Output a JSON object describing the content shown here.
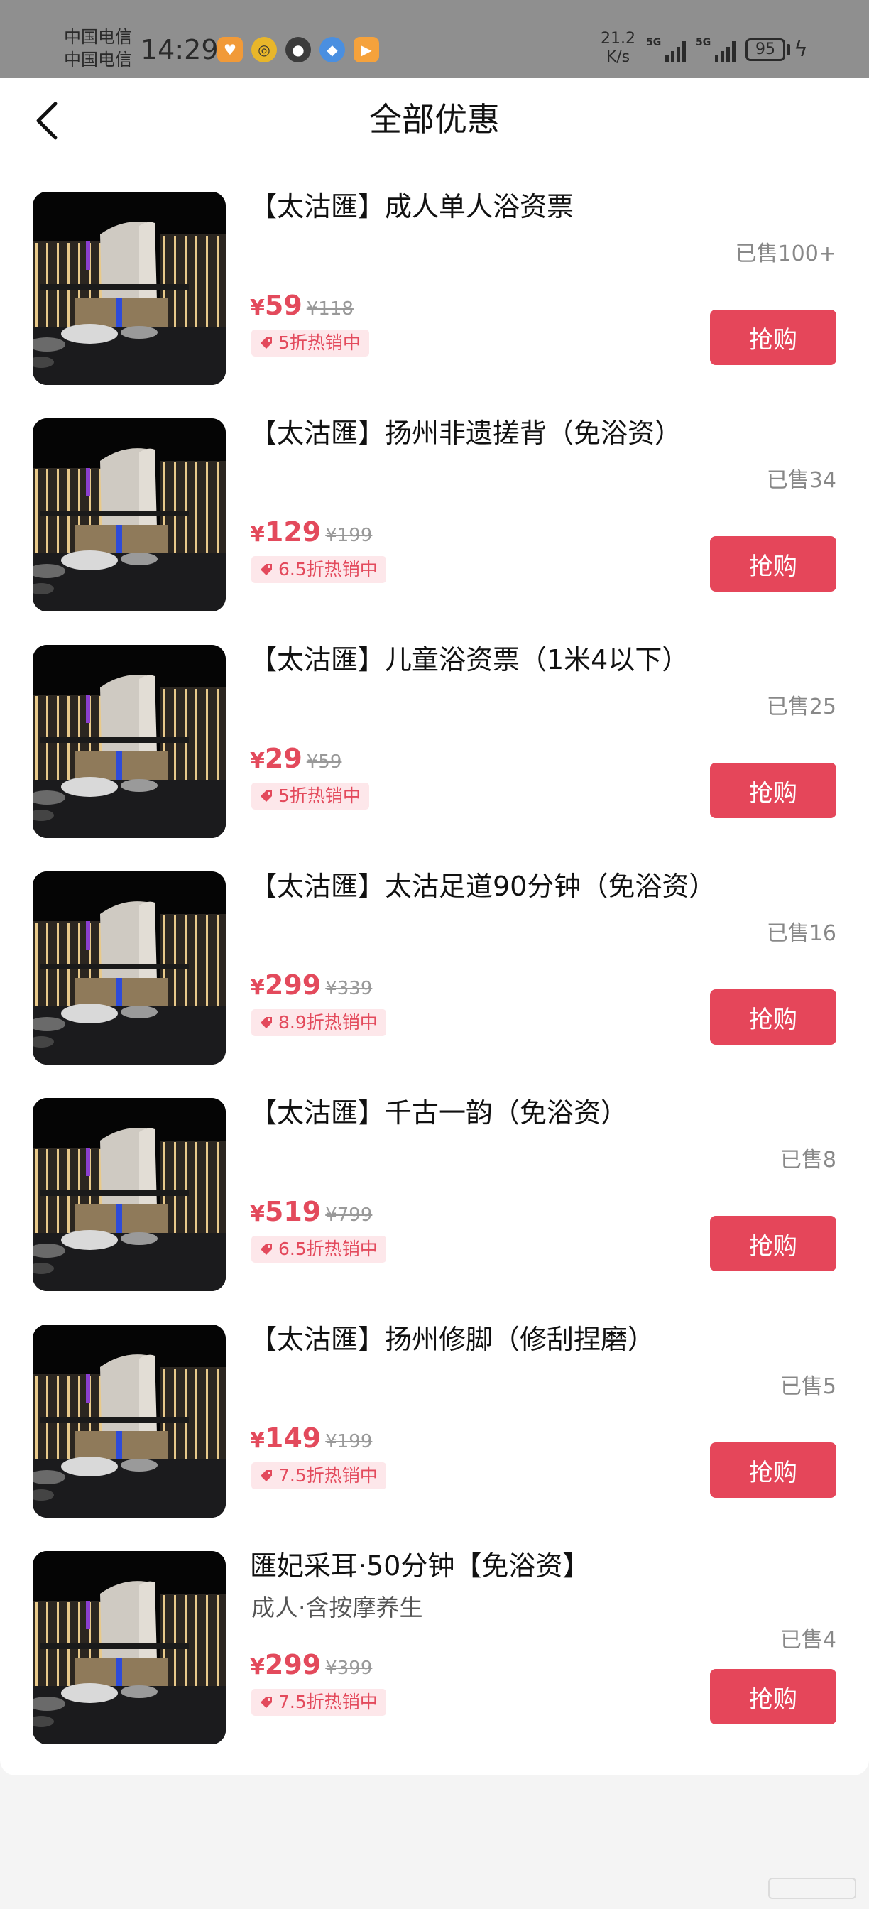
{
  "status_bar": {
    "carrier1": "中国电信",
    "carrier2": "中国电信",
    "time": "14:29",
    "net_speed_value": "21.2",
    "net_speed_unit": "K/s",
    "signal_tag": "5G",
    "battery": "95"
  },
  "header": {
    "title": "全部优惠"
  },
  "buy_label": "抢购",
  "items": [
    {
      "title": "【太沽匯】成人单人浴资票",
      "subtitle": "",
      "sold": "已售100+",
      "price": "59",
      "original": "¥118",
      "discount": "5折热销中"
    },
    {
      "title": "【太沽匯】扬州非遗搓背（免浴资）",
      "subtitle": "",
      "sold": "已售34",
      "price": "129",
      "original": "¥199",
      "discount": "6.5折热销中"
    },
    {
      "title": "【太沽匯】儿童浴资票（1米4以下）",
      "subtitle": "",
      "sold": "已售25",
      "price": "29",
      "original": "¥59",
      "discount": "5折热销中"
    },
    {
      "title": "【太沽匯】太沽足道90分钟（免浴资）",
      "subtitle": "",
      "sold": "已售16",
      "price": "299",
      "original": "¥339",
      "discount": "8.9折热销中"
    },
    {
      "title": "【太沽匯】千古一韵（免浴资）",
      "subtitle": "",
      "sold": "已售8",
      "price": "519",
      "original": "¥799",
      "discount": "6.5折热销中"
    },
    {
      "title": "【太沽匯】扬州修脚（修刮捏磨）",
      "subtitle": "",
      "sold": "已售5",
      "price": "149",
      "original": "¥199",
      "discount": "7.5折热销中"
    },
    {
      "title": "匯妃采耳·50分钟【免浴资】",
      "subtitle": "成人·含按摩养生",
      "sold": "已售4",
      "price": "299",
      "original": "¥399",
      "discount": "7.5折热销中"
    }
  ],
  "colors": {
    "accent": "#e5465a",
    "price": "#e34a5c",
    "badge_bg": "#fde7ea"
  }
}
